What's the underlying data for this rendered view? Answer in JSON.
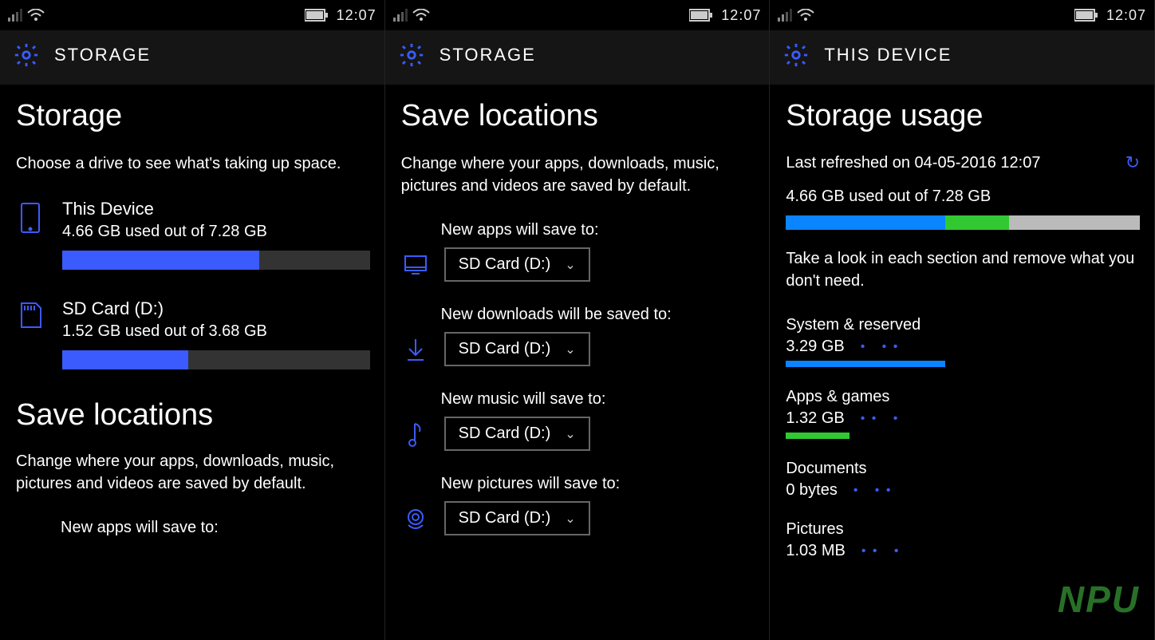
{
  "statusbar": {
    "time": "12:07"
  },
  "screen1": {
    "header": "STORAGE",
    "title": "Storage",
    "subtitle": "Choose a drive to see what's taking up space.",
    "drives": [
      {
        "name": "This Device",
        "usage_text": "4.66 GB used out of 7.28 GB",
        "fill_pct": 64
      },
      {
        "name": "SD Card (D:)",
        "usage_text": "1.52 GB used out of 3.68 GB",
        "fill_pct": 41
      }
    ],
    "save_heading": "Save locations",
    "save_desc": "Change where your apps, downloads, music, pictures and videos are saved by default.",
    "first_save_label": "New apps will save to:"
  },
  "screen2": {
    "header": "STORAGE",
    "title": "Save locations",
    "subtitle": "Change where your apps, downloads, music, pictures and videos are saved by default.",
    "rows": [
      {
        "label": "New apps will save to:",
        "value": "SD Card (D:)"
      },
      {
        "label": "New downloads will be saved to:",
        "value": "SD Card (D:)"
      },
      {
        "label": "New music will save to:",
        "value": "SD Card (D:)"
      },
      {
        "label": "New pictures will save to:",
        "value": "SD Card (D:)"
      }
    ]
  },
  "screen3": {
    "header": "THIS DEVICE",
    "title": "Storage usage",
    "last_refreshed": "Last refreshed on 04-05-2016 12:07",
    "summary": "4.66 GB used out of 7.28 GB",
    "multi_pct": {
      "blue": 45,
      "green": 18,
      "gray": 37
    },
    "hint": "Take a look in each section and remove what you don't need.",
    "categories": [
      {
        "name": "System & reserved",
        "size": "3.29 GB",
        "fill_pct": 45,
        "color": "blue"
      },
      {
        "name": "Apps & games",
        "size": "1.32 GB",
        "fill_pct": 18,
        "color": "green"
      },
      {
        "name": "Documents",
        "size": "0 bytes",
        "fill_pct": 0,
        "color": "blue"
      },
      {
        "name": "Pictures",
        "size": "1.03 MB",
        "fill_pct": 0,
        "color": "blue"
      }
    ],
    "watermark": "NPU"
  }
}
